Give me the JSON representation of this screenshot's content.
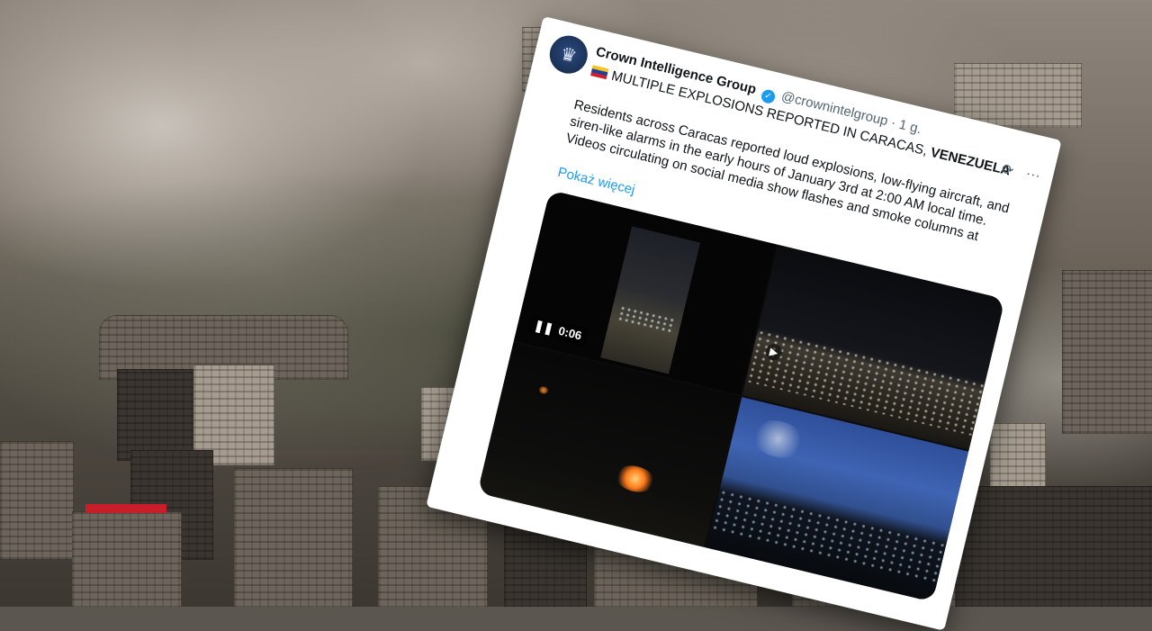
{
  "tweet": {
    "author_name": "Crown Intelligence Group",
    "author_handle": "@crownintelgroup",
    "timestamp": "· 1 g.",
    "headline": "MULTIPLE EXPLOSIONS REPORTED IN CARACAS, ",
    "headline_bold": "VENEZUELA",
    "body_lines": [
      "Residents across Caracas reported loud explosions, low-flying aircraft, and",
      "siren-like alarms in the early hours of January 3rd at 2:00 AM local time.",
      "Videos circulating on social media show flashes and smoke columns at"
    ],
    "show_more": "Pokaż więcej",
    "video_time": "0:06",
    "icons": {
      "verified": "verified-badge-icon",
      "flag": "venezuela-flag-icon",
      "grok": "grok-icon",
      "more": "more-icon",
      "pause": "pause-icon",
      "play": "play-icon"
    },
    "colors": {
      "verified": "#1d9bf0",
      "link": "#1d9bf0",
      "secondary_text": "#536471"
    }
  }
}
